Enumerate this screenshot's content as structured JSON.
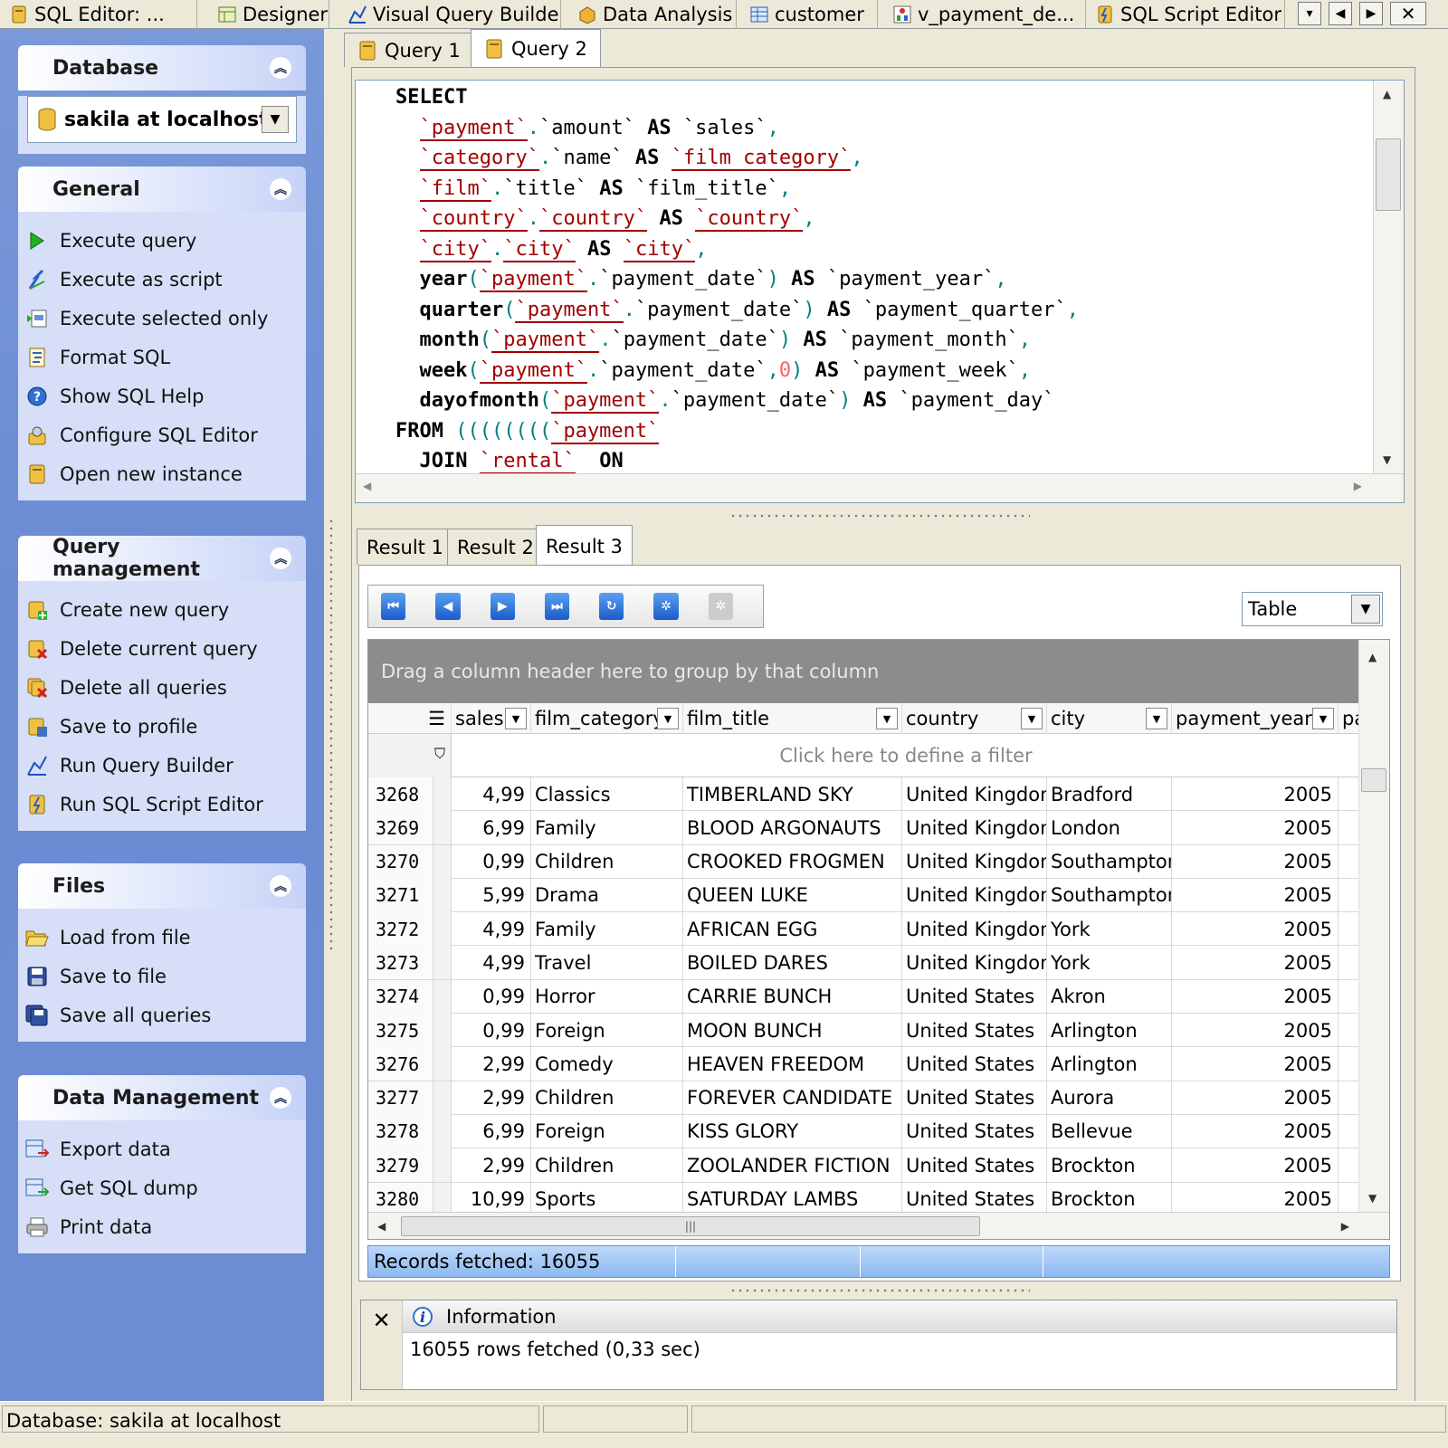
{
  "top_tabs": [
    {
      "label": "SQL Editor: ...",
      "icon": "sql-editor-icon"
    },
    {
      "label": "Designer",
      "icon": "designer-icon"
    },
    {
      "label": "Visual Query Builder",
      "icon": "query-builder-icon"
    },
    {
      "label": "Data Analysis",
      "icon": "data-analysis-icon"
    },
    {
      "label": "customer",
      "icon": "table-icon"
    },
    {
      "label": "v_payment_de...",
      "icon": "view-icon"
    },
    {
      "label": "SQL Script Editor",
      "icon": "script-icon"
    }
  ],
  "sidebar": {
    "database": {
      "title": "Database",
      "selected": "sakila at localhost"
    },
    "general": {
      "title": "General",
      "items": [
        {
          "label": "Execute query",
          "icon": "play-icon"
        },
        {
          "label": "Execute as script",
          "icon": "script-run-icon"
        },
        {
          "label": "Execute selected only",
          "icon": "execute-selected-icon"
        },
        {
          "label": "Format SQL",
          "icon": "format-icon"
        },
        {
          "label": "Show SQL Help",
          "icon": "help-icon"
        },
        {
          "label": "Configure SQL Editor",
          "icon": "configure-icon"
        },
        {
          "label": "Open new instance",
          "icon": "new-instance-icon"
        }
      ]
    },
    "query_management": {
      "title": "Query management",
      "items": [
        {
          "label": "Create new query",
          "icon": "create-query-icon"
        },
        {
          "label": "Delete current query",
          "icon": "delete-query-icon"
        },
        {
          "label": "Delete all queries",
          "icon": "delete-all-icon"
        },
        {
          "label": "Save to profile",
          "icon": "save-profile-icon"
        },
        {
          "label": "Run Query Builder",
          "icon": "query-builder-icon"
        },
        {
          "label": "Run SQL Script Editor",
          "icon": "script-icon"
        }
      ]
    },
    "files": {
      "title": "Files",
      "items": [
        {
          "label": "Load from file",
          "icon": "folder-open-icon"
        },
        {
          "label": "Save to file",
          "icon": "floppy-icon"
        },
        {
          "label": "Save all queries",
          "icon": "save-all-icon"
        }
      ]
    },
    "data_management": {
      "title": "Data Management",
      "items": [
        {
          "label": "Export data",
          "icon": "export-icon"
        },
        {
          "label": "Get SQL dump",
          "icon": "dump-icon"
        },
        {
          "label": "Print data",
          "icon": "printer-icon"
        }
      ]
    }
  },
  "query_tabs": [
    {
      "label": "Query 1"
    },
    {
      "label": "Query 2"
    }
  ],
  "result_tabs": [
    {
      "label": "Result 1"
    },
    {
      "label": "Result 2"
    },
    {
      "label": "Result 3"
    }
  ],
  "view_select": "Table",
  "grid": {
    "group_hint": "Drag a column header here to group by that column",
    "filter_hint": "Click here to define a filter",
    "columns": [
      "sales",
      "film_category",
      "film_title",
      "country",
      "city",
      "payment_year",
      "pa"
    ],
    "rows": [
      {
        "id": "3268",
        "sales": "4,99",
        "category": "Classics",
        "title": "TIMBERLAND SKY",
        "country": "United Kingdom",
        "city": "Bradford",
        "year": "2005"
      },
      {
        "id": "3269",
        "sales": "6,99",
        "category": "Family",
        "title": "BLOOD ARGONAUTS",
        "country": "United Kingdom",
        "city": "London",
        "year": "2005"
      },
      {
        "id": "3270",
        "sales": "0,99",
        "category": "Children",
        "title": "CROOKED FROGMEN",
        "country": "United Kingdom",
        "city": "Southampton",
        "year": "2005"
      },
      {
        "id": "3271",
        "sales": "5,99",
        "category": "Drama",
        "title": "QUEEN LUKE",
        "country": "United Kingdom",
        "city": "Southampton",
        "year": "2005"
      },
      {
        "id": "3272",
        "sales": "4,99",
        "category": "Family",
        "title": "AFRICAN EGG",
        "country": "United Kingdom",
        "city": "York",
        "year": "2005"
      },
      {
        "id": "3273",
        "sales": "4,99",
        "category": "Travel",
        "title": "BOILED DARES",
        "country": "United Kingdom",
        "city": "York",
        "year": "2005"
      },
      {
        "id": "3274",
        "sales": "0,99",
        "category": "Horror",
        "title": "CARRIE BUNCH",
        "country": "United States",
        "city": "Akron",
        "year": "2005"
      },
      {
        "id": "3275",
        "sales": "0,99",
        "category": "Foreign",
        "title": "MOON BUNCH",
        "country": "United States",
        "city": "Arlington",
        "year": "2005"
      },
      {
        "id": "3276",
        "sales": "2,99",
        "category": "Comedy",
        "title": "HEAVEN FREEDOM",
        "country": "United States",
        "city": "Arlington",
        "year": "2005"
      },
      {
        "id": "3277",
        "sales": "2,99",
        "category": "Children",
        "title": "FOREVER CANDIDATE",
        "country": "United States",
        "city": "Aurora",
        "year": "2005"
      },
      {
        "id": "3278",
        "sales": "6,99",
        "category": "Foreign",
        "title": "KISS GLORY",
        "country": "United States",
        "city": "Bellevue",
        "year": "2005"
      },
      {
        "id": "3279",
        "sales": "2,99",
        "category": "Children",
        "title": "ZOOLANDER FICTION",
        "country": "United States",
        "city": "Brockton",
        "year": "2005"
      },
      {
        "id": "3280",
        "sales": "10,99",
        "category": "Sports",
        "title": "SATURDAY LAMBS",
        "country": "United States",
        "city": "Brockton",
        "year": "2005"
      }
    ]
  },
  "records_fetched": "Records fetched: 16055",
  "info": {
    "title": "Information",
    "message": "16055 rows fetched (0,33 sec)"
  },
  "status_bar": {
    "database": "Database: sakila at localhost"
  }
}
